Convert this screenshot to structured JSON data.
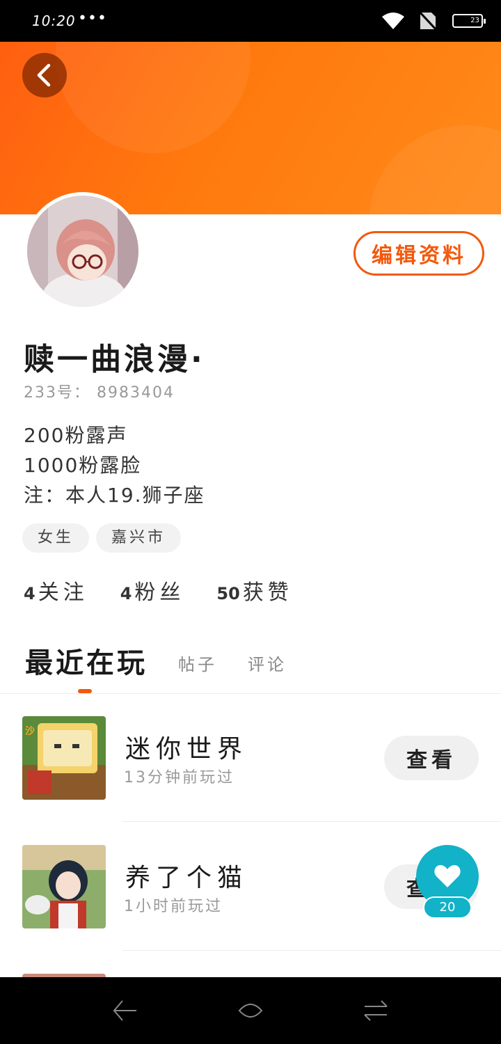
{
  "status_bar": {
    "time": "10:20",
    "dots": "•••",
    "battery": "23"
  },
  "header": {
    "back_icon": "chevron-left-icon",
    "banner_color": "#ff7a0e"
  },
  "profile": {
    "edit_label": "编辑资料",
    "nickname": "赎一曲浪漫·",
    "id_text": "233号： 8983404",
    "bio_lines": [
      "200粉露声",
      "1000粉露脸",
      "注：本人19.狮子座"
    ],
    "tags": [
      "女生",
      "嘉兴市"
    ],
    "stats": [
      {
        "num": "4",
        "label": "关注"
      },
      {
        "num": "4",
        "label": "粉丝"
      },
      {
        "num": "50",
        "label": "获赞"
      }
    ]
  },
  "tabs": {
    "active": "最近在玩",
    "items": [
      "帖子",
      "评论"
    ]
  },
  "games": [
    {
      "name": "迷你世界",
      "time": "13分钟前玩过",
      "button": "查看"
    },
    {
      "name": "养了个猫",
      "time": "1小时前玩过",
      "button": "查看"
    }
  ],
  "like": {
    "count": "20",
    "accent": "#12b2c8"
  },
  "colors": {
    "accent": "#f2590c"
  }
}
